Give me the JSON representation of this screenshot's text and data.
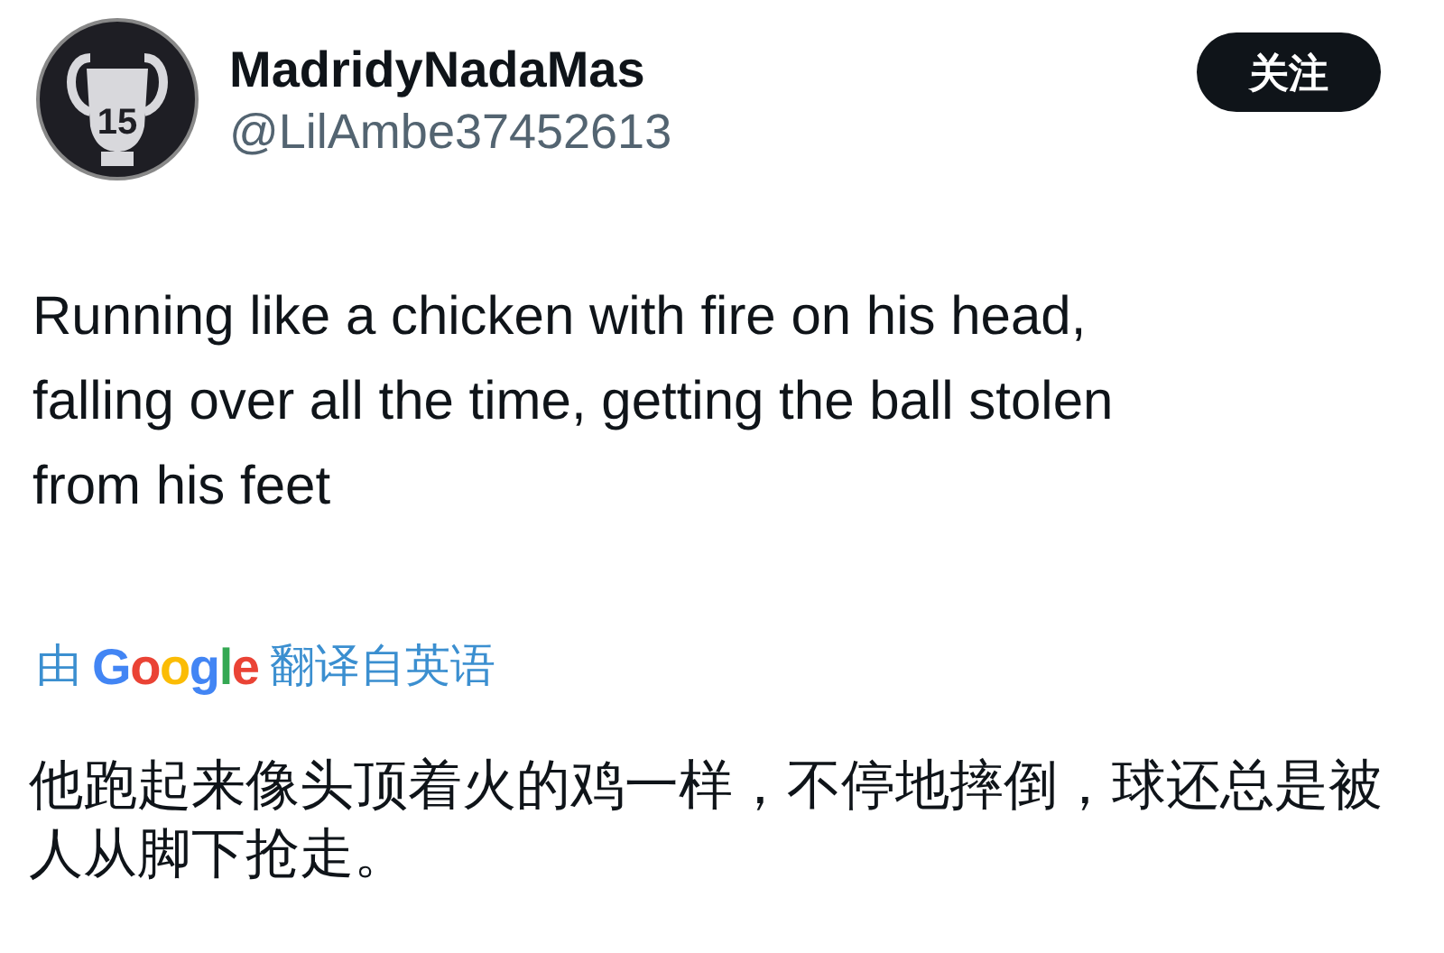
{
  "author": {
    "avatar_badge": "15",
    "name": "MadridyNadaMas",
    "handle": "@LilAmbe37452613"
  },
  "follow_button": {
    "label": "关注"
  },
  "tweet_text": "Running like a chicken with fire on his head, falling over all the time, getting the ball stolen from his feet",
  "translation": {
    "prefix": "由",
    "brand": "Google",
    "suffix": "翻译自英语"
  },
  "translated_text": "他跑起来像头顶着火的鸡一样，不停地摔倒，球还总是被人从脚下抢走。"
}
